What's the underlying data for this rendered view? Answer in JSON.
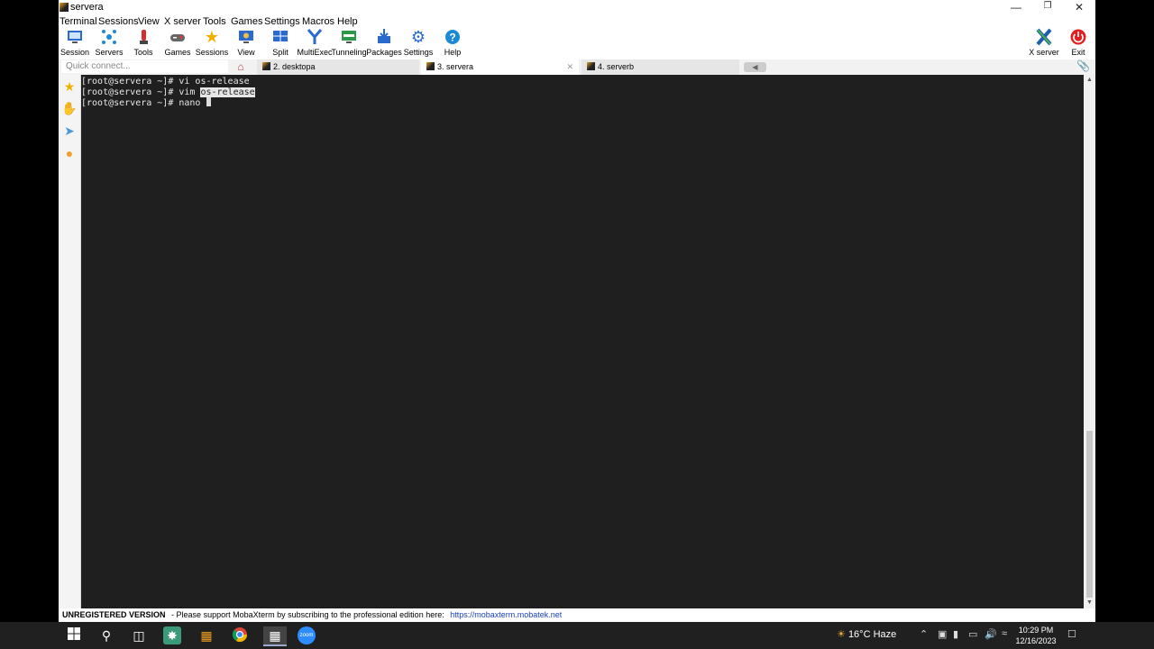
{
  "window": {
    "title": "servera"
  },
  "menu": [
    "Terminal",
    "Sessions",
    "View",
    "X server",
    "Tools",
    "Games",
    "Settings",
    "Macros",
    "Help"
  ],
  "toolbar": {
    "items": [
      {
        "label": "Session",
        "icon": "session-icon",
        "color": "#2a6ad0"
      },
      {
        "label": "Servers",
        "icon": "servers-icon",
        "color": "#1a8ad8"
      },
      {
        "label": "Tools",
        "icon": "tools-icon",
        "color": "#d03030"
      },
      {
        "label": "Games",
        "icon": "games-icon",
        "color": "#555555"
      },
      {
        "label": "Sessions",
        "icon": "star-icon",
        "color": "#f0b000"
      },
      {
        "label": "View",
        "icon": "view-icon",
        "color": "#2a6ad0"
      },
      {
        "label": "Split",
        "icon": "split-icon",
        "color": "#2a6ad0"
      },
      {
        "label": "MultiExec",
        "icon": "multiexec-icon",
        "color": "#2a6ad0"
      },
      {
        "label": "Tunneling",
        "icon": "tunneling-icon",
        "color": "#2a9a4a"
      },
      {
        "label": "Packages",
        "icon": "packages-icon",
        "color": "#2a6ad0"
      },
      {
        "label": "Settings",
        "icon": "gear-icon",
        "color": "#2a6ad0"
      },
      {
        "label": "Help",
        "icon": "help-icon",
        "color": "#1a8ad8"
      }
    ],
    "xserver_label": "X server",
    "exit_label": "Exit"
  },
  "tabs": {
    "quick_connect_placeholder": "Quick connect...",
    "items": [
      {
        "label": "2. desktopa",
        "active": false
      },
      {
        "label": "3. servera",
        "active": true
      },
      {
        "label": "4. serverb",
        "active": false
      }
    ]
  },
  "terminal": {
    "lines": [
      {
        "prefix": "[root@servera ~]# vi os-release",
        "highlight": "",
        "suffix": ""
      },
      {
        "prefix": "[root@servera ~]# vim ",
        "highlight": "os-release",
        "suffix": ""
      },
      {
        "prefix": "[root@servera ~]# nano ",
        "highlight": "",
        "suffix": "",
        "cursor": true
      }
    ]
  },
  "status": {
    "unregistered": "UNREGISTERED VERSION",
    "message": "-  Please support MobaXterm by subscribing to the professional edition here:",
    "link": "https://mobaxterm.mobatek.net"
  },
  "taskbar": {
    "weather": "16°C  Haze",
    "time": "10:29 PM",
    "date": "12/16/2023",
    "zoom_label": "zoom"
  }
}
